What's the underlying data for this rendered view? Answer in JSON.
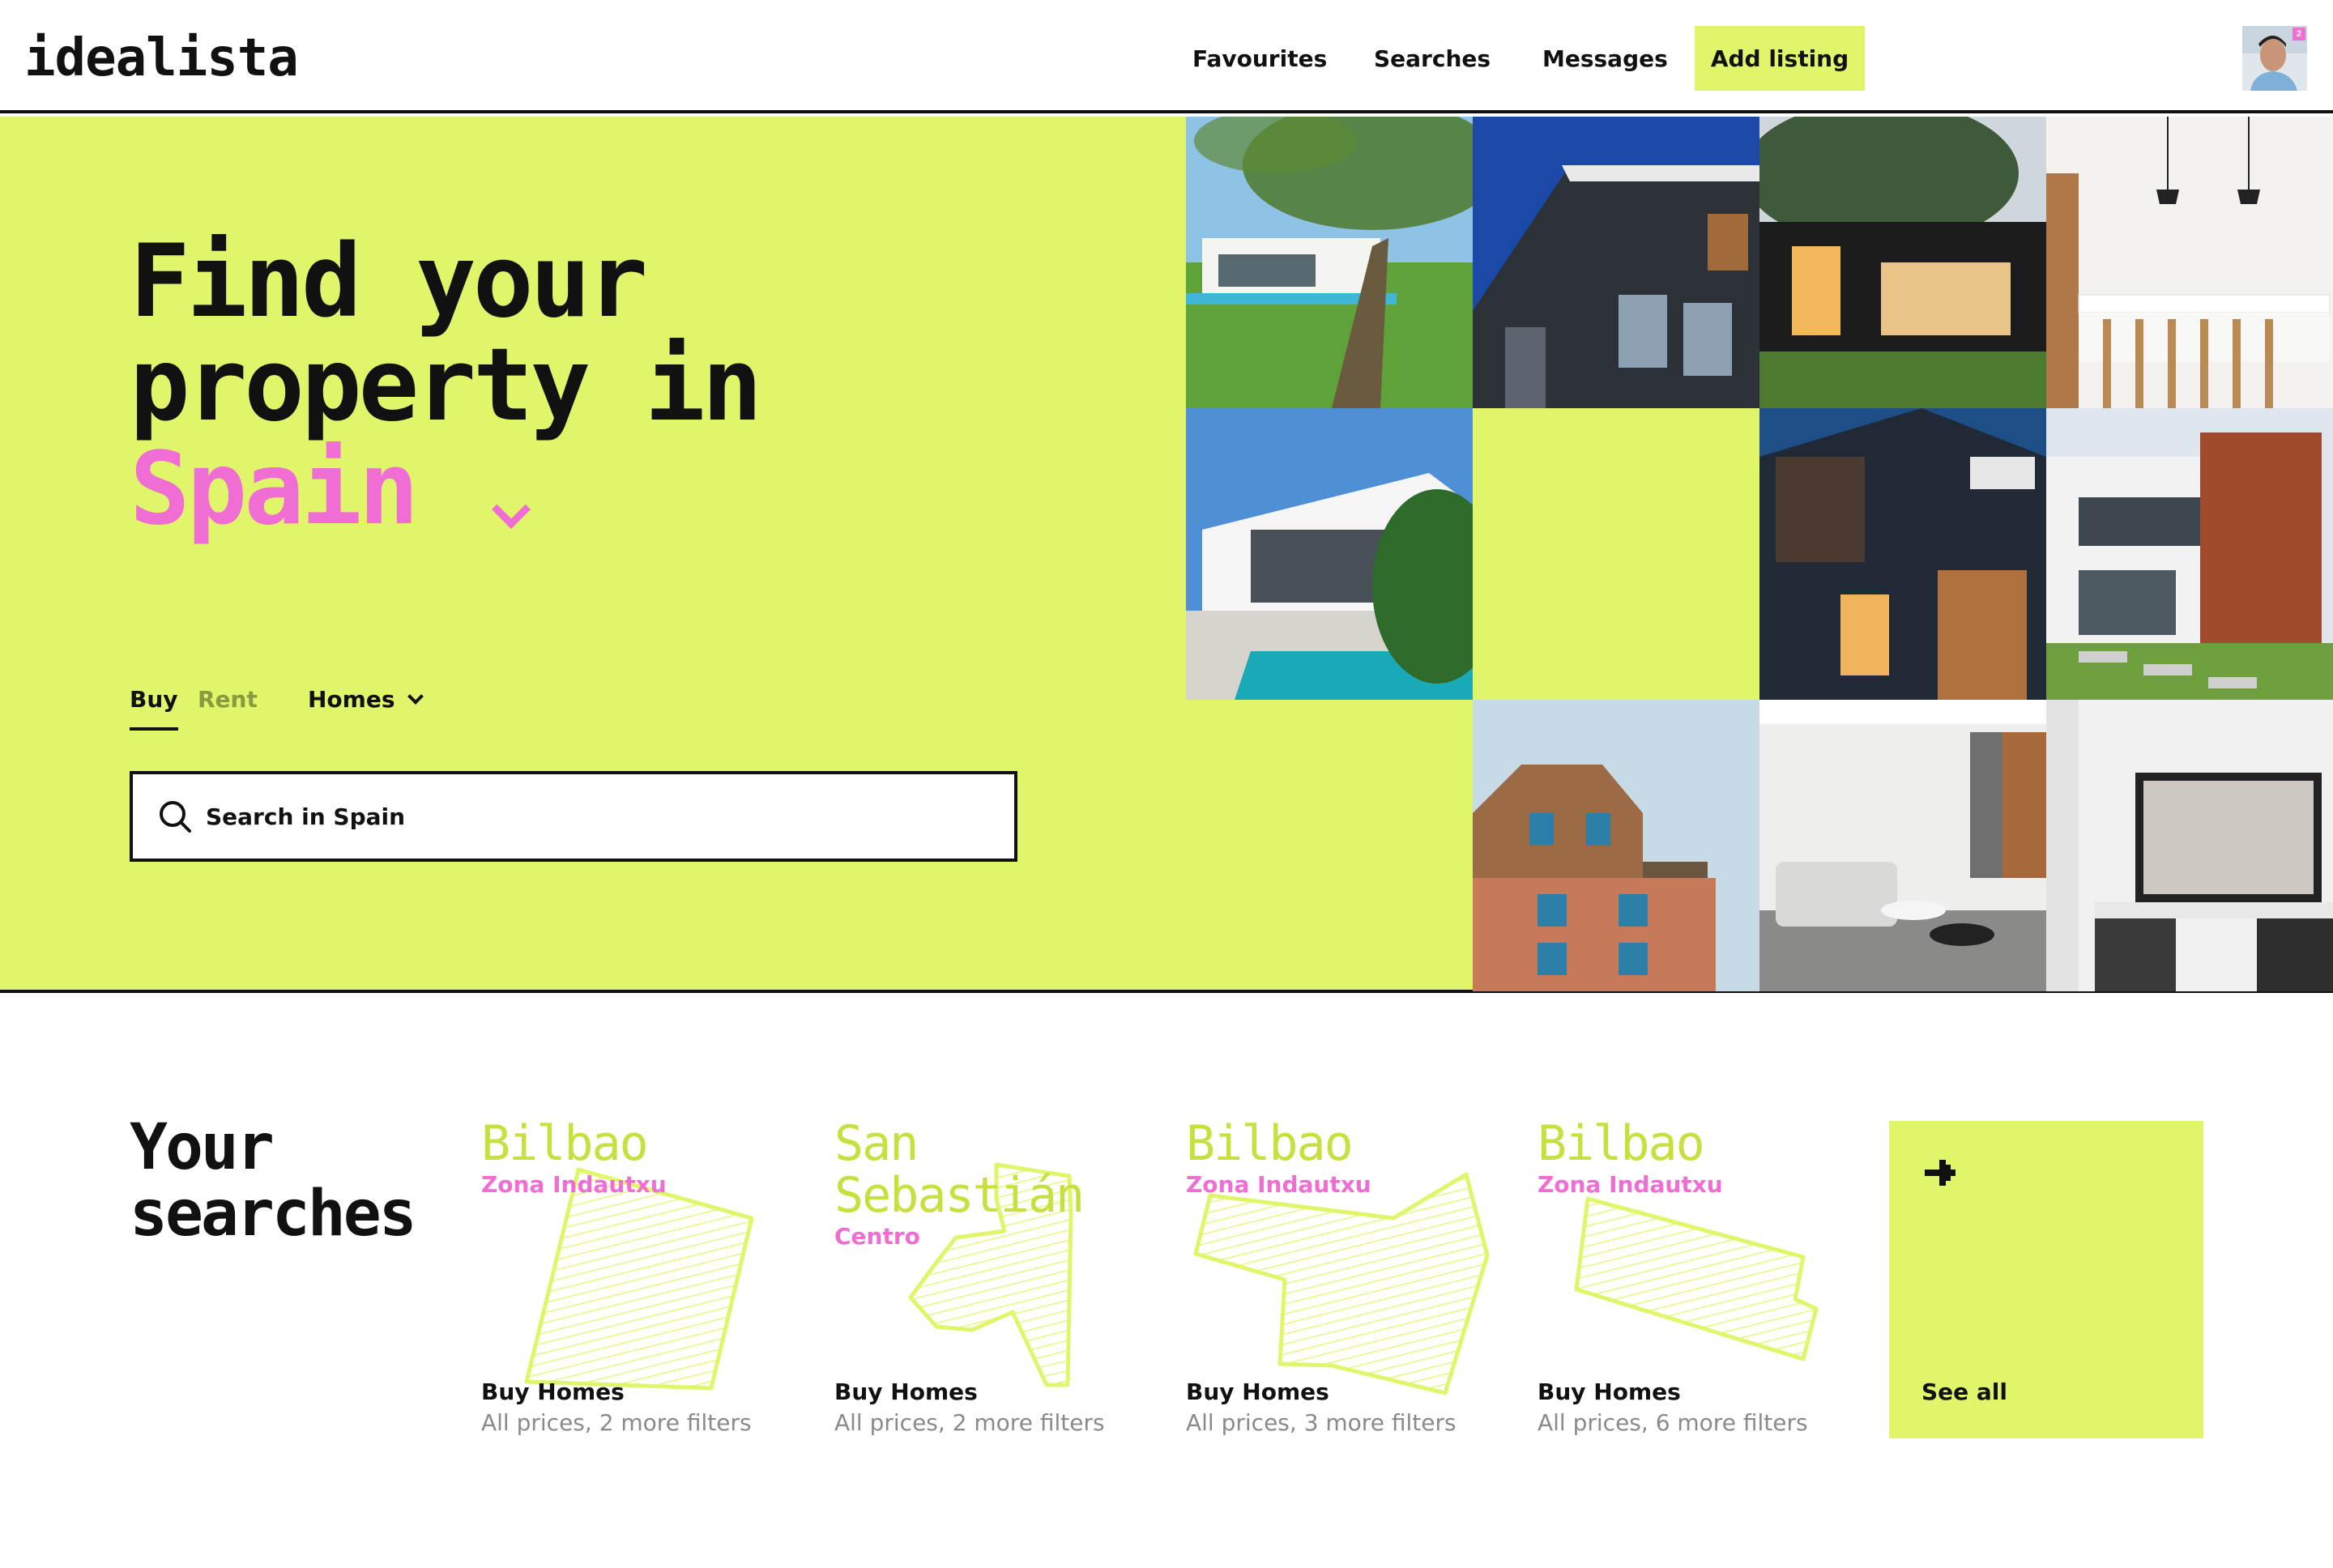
{
  "header": {
    "logo": "idealista",
    "nav": [
      "Favourites",
      "Searches",
      "Messages"
    ],
    "add_listing": "Add listing",
    "notification_count": "2"
  },
  "hero": {
    "title_line1": "Find your",
    "title_line2": "property in",
    "location": "Spain",
    "tabs": {
      "buy": "Buy",
      "rent": "Rent",
      "type": "Homes"
    },
    "search_placeholder": "Search in Spain"
  },
  "searches": {
    "title_line1": "Your",
    "title_line2": "searches",
    "items": [
      {
        "city": "Bilbao",
        "zone": "Zona Indautxu",
        "operation": "Buy Homes",
        "filters": "All prices, 2 more filters"
      },
      {
        "city": "San Sebastián",
        "zone": "Centro",
        "operation": "Buy Homes",
        "filters": "All prices, 2 more filters"
      },
      {
        "city": "Bilbao",
        "zone": "Zona Indautxu",
        "operation": "Buy Homes",
        "filters": "All prices, 3 more filters"
      },
      {
        "city": "Bilbao",
        "zone": "Zona Indautxu",
        "operation": "Buy Homes",
        "filters": "All prices, 6 more filters"
      }
    ],
    "see_all": "See all"
  },
  "colors": {
    "accent": "#e1f56a",
    "pink": "#f06ed3",
    "dark": "#111111",
    "city_green": "#c8e03e"
  }
}
